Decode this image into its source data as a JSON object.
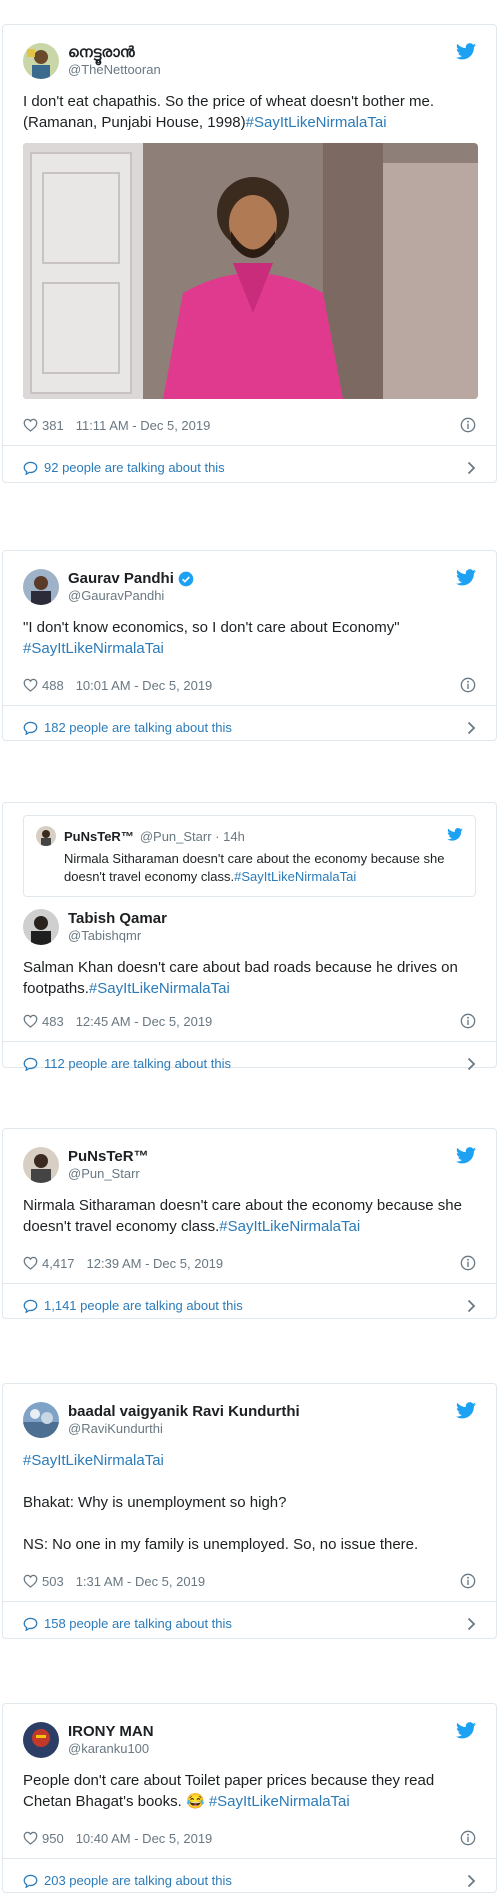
{
  "colors": {
    "link": "#2b7bb9",
    "muted": "#697882",
    "border": "#e1e8ed",
    "twitter_blue": "#1da1f2"
  },
  "tweets": [
    {
      "display_name": "നെട്ടൂരാൻ",
      "handle": "@TheNettooran",
      "text": "I don't eat chapathis. So the price of wheat doesn't bother me. (Ramanan, Punjabi House, 1998)",
      "hashtag": "#SayItLikeNirmalaTai",
      "likes": "381",
      "time": "11:11 AM - Dec 5, 2019",
      "talking": "92 people are talking about this"
    },
    {
      "display_name": "Gaurav Pandhi",
      "handle": "@GauravPandhi",
      "text": "\"I don't know economics, so I don't care about Economy\"",
      "hashtag": "#SayItLikeNirmalaTai",
      "likes": "488",
      "time": "10:01 AM - Dec 5, 2019",
      "talking": "182 people are talking about this"
    },
    {
      "quote": {
        "display_name": "PuNsTeR™",
        "handle": "@Pun_Starr · 14h",
        "text": "Nirmala Sitharaman doesn't care about the economy because she doesn't travel economy class.",
        "hashtag": "#SayItLikeNirmalaTai"
      },
      "display_name": "Tabish Qamar",
      "handle": "@Tabishqmr",
      "text": "Salman Khan doesn't care about bad roads because he drives on footpaths.",
      "hashtag": "#SayItLikeNirmalaTai",
      "likes": "483",
      "time": "12:45 AM - Dec 5, 2019",
      "talking": "112 people are talking about this"
    },
    {
      "display_name": "PuNsTeR™",
      "handle": "@Pun_Starr",
      "text": "Nirmala Sitharaman doesn't care about the economy because she doesn't travel economy class.",
      "hashtag": "#SayItLikeNirmalaTai",
      "likes": "4,417",
      "time": "12:39 AM - Dec 5, 2019",
      "talking": "1,141 people are talking about this"
    },
    {
      "display_name": "baadal vaigyanik Ravi Kundurthi",
      "handle": "@RaviKundurthi",
      "hashtag": "#SayItLikeNirmalaTai",
      "line1": "Bhakat: Why is unemployment so high?",
      "line2": "NS: No one in my family is unemployed. So, no issue there.",
      "likes": "503",
      "time": "1:31 AM - Dec 5, 2019",
      "talking": "158 people are talking about this"
    },
    {
      "display_name": "IRONY MAN",
      "handle": "@karanku100",
      "text": "People don't care about Toilet paper prices because they read Chetan Bhagat's books. 😂",
      "hashtag": "#SayItLikeNirmalaTai",
      "likes": "950",
      "time": "10:40 AM - Dec 5, 2019",
      "talking": "203 people are talking about this"
    }
  ]
}
